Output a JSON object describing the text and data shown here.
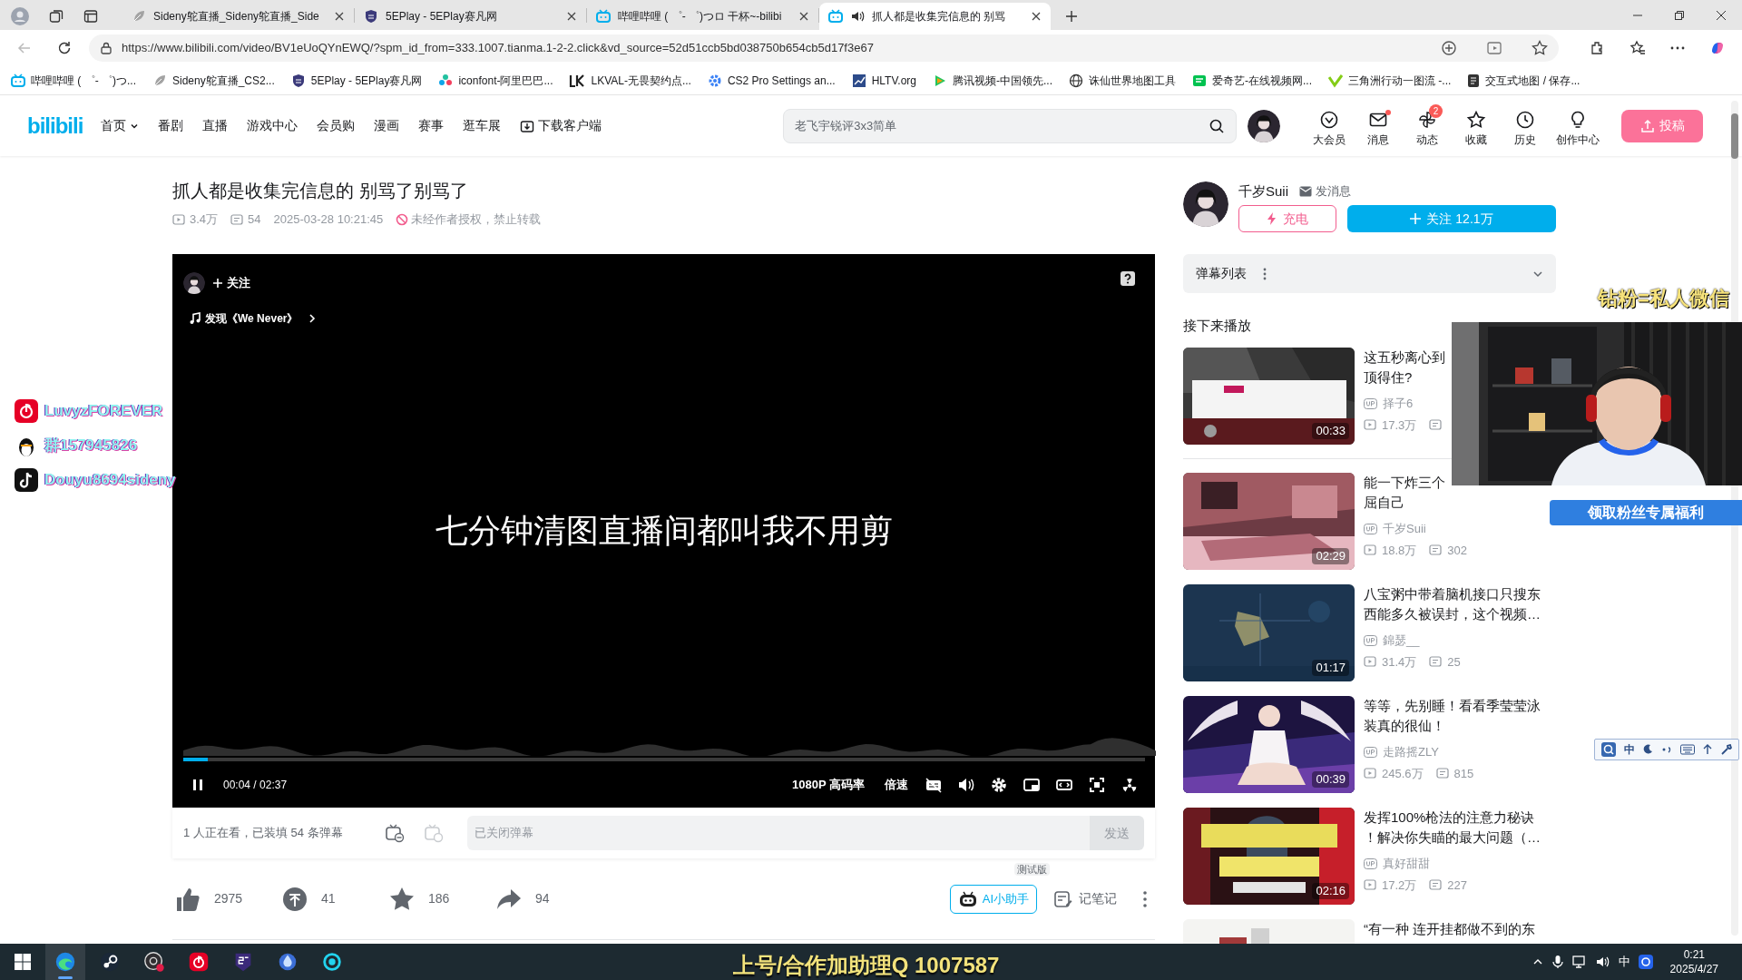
{
  "browser": {
    "tabs": [
      {
        "title": "Sideny鸵直播_Sideny鸵直播_Side",
        "kind": "page",
        "selected": false,
        "audio": false
      },
      {
        "title": "5EPlay - 5EPlay赛凡网",
        "kind": "shield",
        "selected": false,
        "audio": false
      },
      {
        "title": "哔哩哔哩 ( ゜- ゜)つロ 干杯~-bilibi",
        "kind": "tv",
        "selected": false,
        "audio": false
      },
      {
        "title": "抓人都是收集完信息的 别骂",
        "kind": "tv",
        "selected": true,
        "audio": true
      }
    ],
    "url": "https://www.bilibili.com/video/BV1eUoQYnEWQ/?spm_id_from=333.1007.tianma.1-2-2.click&vd_source=52d51ccb5bd038750b654cb5d17f3e67",
    "bookmarks": [
      {
        "label": "哔哩哔哩 ( ゜- ゜)つ...",
        "kind": "tv"
      },
      {
        "label": "Sideny鸵直播_CS2...",
        "kind": "page"
      },
      {
        "label": "5EPlay - 5EPlay赛凡网",
        "kind": "shield"
      },
      {
        "label": "iconfont-阿里巴巴...",
        "kind": "flower"
      },
      {
        "label": "LKVAL-无畏契约点...",
        "kind": "lk"
      },
      {
        "label": "CS2 Pro Settings an...",
        "kind": "gear"
      },
      {
        "label": "HLTV.org",
        "kind": "chart"
      },
      {
        "label": "腾讯视频-中国领先...",
        "kind": "play"
      },
      {
        "label": "诛仙世界地图工具",
        "kind": "globe"
      },
      {
        "label": "爱奇艺-在线视频网...",
        "kind": "green"
      },
      {
        "label": "三角洲行动一图流 -...",
        "kind": "delta"
      },
      {
        "label": "交互式地图 / 保存...",
        "kind": "dark"
      }
    ]
  },
  "header": {
    "logo": "bilibili",
    "nav": [
      {
        "label": "首页",
        "dropdown": true
      },
      {
        "label": "番剧",
        "dropdown": false
      },
      {
        "label": "直播",
        "dropdown": false
      },
      {
        "label": "游戏中心",
        "dropdown": false
      },
      {
        "label": "会员购",
        "dropdown": false
      },
      {
        "label": "漫画",
        "dropdown": false
      },
      {
        "label": "赛事",
        "dropdown": false
      },
      {
        "label": "逛车展",
        "dropdown": false
      },
      {
        "label": "下载客户端",
        "dropdown": false
      }
    ],
    "search": {
      "placeholder": "老飞宇锐评3x3简单"
    },
    "menu": [
      {
        "label": "大会员",
        "kind": "vip"
      },
      {
        "label": "消息",
        "kind": "mail",
        "dot": true
      },
      {
        "label": "动态",
        "kind": "wind",
        "badge": "2"
      },
      {
        "label": "收藏",
        "kind": "star"
      },
      {
        "label": "历史",
        "kind": "clock"
      },
      {
        "label": "创作中心",
        "kind": "bulb"
      }
    ],
    "upload": "投稿"
  },
  "video": {
    "title": "抓人都是收集完信息的 别骂了别骂了",
    "views": "3.4万",
    "danmaku": "54",
    "date": "2025-03-28 10:21:45",
    "notice": "未经作者授权，禁止转载"
  },
  "player": {
    "follow": "关注",
    "music": "发现《We Never》",
    "subtitle": "七分钟清图直播间都叫我不用剪",
    "level": 0.025,
    "time": "00:04 / 02:37",
    "quality": "1080P 高码率",
    "speed": "倍速",
    "playing": true
  },
  "danmaku_bar": {
    "status": "1 人正在看，已装填 54 条弹幕",
    "placeholder": "已关闭弹幕",
    "send": "发送"
  },
  "actions": {
    "like": "2975",
    "coin": "41",
    "favorite": "186",
    "share": "94",
    "assistant": "AI小助手",
    "assistant_badge": "测试版",
    "notes": "记笔记"
  },
  "uploader": {
    "name": "千岁Suii",
    "message": "发消息",
    "charge": "充电",
    "follow": "关注 12.1万"
  },
  "danmaku_list": {
    "title": "弹幕列表"
  },
  "up_next": {
    "title": "接下来播放"
  },
  "recommendations": [
    {
      "title_lines": [
        "这五秒离心到",
        "顶得住?"
      ],
      "uploader": "择子6",
      "views": "17.3万",
      "duration": "00:33",
      "kind": "game"
    },
    {
      "title_lines": [
        "能一下炸三个",
        "屈自己"
      ],
      "uploader": "千岁Suii",
      "views": "18.8万",
      "danmaku": "302",
      "duration": "02:29",
      "kind": "pink"
    },
    {
      "title_lines": [
        "八宝粥中带着脑机接口只搜东",
        "西能多久被误封，这个视频…"
      ],
      "uploader": "錦瑟__",
      "views": "31.4万",
      "danmaku": "25",
      "duration": "01:17",
      "kind": "radar"
    },
    {
      "title_lines": [
        "等等，先别睡！看看季莹莹泳",
        "装真的很仙！"
      ],
      "uploader": "走路摇ZLY",
      "views": "245.6万",
      "danmaku": "815",
      "duration": "00:39",
      "kind": "figure"
    },
    {
      "title_lines": [
        "发挥100%枪法的注意力秘诀",
        "！解决你失瞄的最大问题（…"
      ],
      "uploader": "真好甜甜",
      "views": "17.2万",
      "danmaku": "227",
      "duration": "02:16",
      "kind": "poster"
    },
    {
      "title_lines": [
        "“有一种 连开挂都做不到的东"
      ],
      "kind": "city"
    }
  ],
  "overlays": {
    "socials": [
      {
        "kind": "netease",
        "text": "LuvyzFOREVER"
      },
      {
        "kind": "qq",
        "text": "群157945826"
      },
      {
        "kind": "douyin",
        "text": "Douyu8694sideny"
      }
    ],
    "fan_banner": "钻粉=私人微信",
    "fan_button": "领取粉丝专属福利",
    "ime": "中",
    "stream_banner": "上号/合作加助理Q 1007587"
  },
  "taskbar": {
    "apps": [
      {
        "kind": "edge",
        "active": true
      },
      {
        "kind": "steam",
        "active": false
      },
      {
        "kind": "obs",
        "active": false
      },
      {
        "kind": "netease",
        "active": false
      },
      {
        "kind": "fivee",
        "active": false
      },
      {
        "kind": "drop",
        "active": false
      },
      {
        "kind": "ring",
        "active": false
      }
    ],
    "ime": "中",
    "time": "0:21",
    "date": "2025/4/27"
  }
}
